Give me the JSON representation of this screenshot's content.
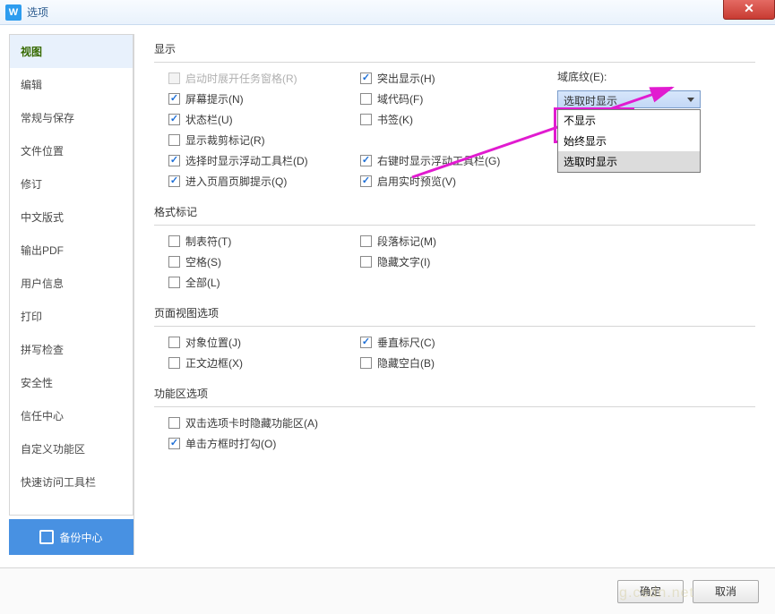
{
  "window": {
    "title": "选项"
  },
  "sidebar": {
    "items": [
      "视图",
      "编辑",
      "常规与保存",
      "文件位置",
      "修订",
      "中文版式",
      "输出PDF",
      "用户信息",
      "打印",
      "拼写检查",
      "安全性",
      "信任中心",
      "自定义功能区",
      "快速访问工具栏"
    ],
    "active_index": 0,
    "backup_label": "备份中心"
  },
  "sections": {
    "display": {
      "title": "显示",
      "items": {
        "startup_taskpane": {
          "label": "启动时展开任务窗格(R)",
          "checked": false,
          "disabled": true
        },
        "screen_tips": {
          "label": "屏幕提示(N)",
          "checked": true
        },
        "status_bar": {
          "label": "状态栏(U)",
          "checked": true
        },
        "crop_marks": {
          "label": "显示裁剪标记(R)",
          "checked": false
        },
        "floating_toolbar": {
          "label": "选择时显示浮动工具栏(D)",
          "checked": true
        },
        "header_footer": {
          "label": "进入页眉页脚提示(Q)",
          "checked": true
        },
        "highlight": {
          "label": "突出显示(H)",
          "checked": true
        },
        "field_codes": {
          "label": "域代码(F)",
          "checked": false
        },
        "bookmarks": {
          "label": "书签(K)",
          "checked": false
        },
        "rc_float_toolbar": {
          "label": "右键时显示浮动工具栏(G)",
          "checked": true
        },
        "live_preview": {
          "label": "启用实时预览(V)",
          "checked": true
        }
      },
      "field_shading": {
        "label": "域底纹(E):",
        "selected": "选取时显示",
        "options": [
          "不显示",
          "始终显示",
          "选取时显示"
        ]
      }
    },
    "marks": {
      "title": "格式标记",
      "items": {
        "tabs": {
          "label": "制表符(T)",
          "checked": false
        },
        "spaces": {
          "label": "空格(S)",
          "checked": false
        },
        "all": {
          "label": "全部(L)",
          "checked": false
        },
        "para": {
          "label": "段落标记(M)",
          "checked": false
        },
        "hidden": {
          "label": "隐藏文字(I)",
          "checked": false
        }
      }
    },
    "pageview": {
      "title": "页面视图选项",
      "items": {
        "obj_pos": {
          "label": "对象位置(J)",
          "checked": false
        },
        "txt_bound": {
          "label": "正文边框(X)",
          "checked": false
        },
        "vruler": {
          "label": "垂直标尺(C)",
          "checked": true
        },
        "hide_ws": {
          "label": "隐藏空白(B)",
          "checked": false
        }
      }
    },
    "ribbon": {
      "title": "功能区选项",
      "items": {
        "dblclick_hide": {
          "label": "双击选项卡时隐藏功能区(A)",
          "checked": false
        },
        "click_check": {
          "label": "单击方框时打勾(O)",
          "checked": true
        }
      }
    }
  },
  "footer": {
    "ok": "确定",
    "cancel": "取消"
  },
  "watermark": "g.csdn.net"
}
